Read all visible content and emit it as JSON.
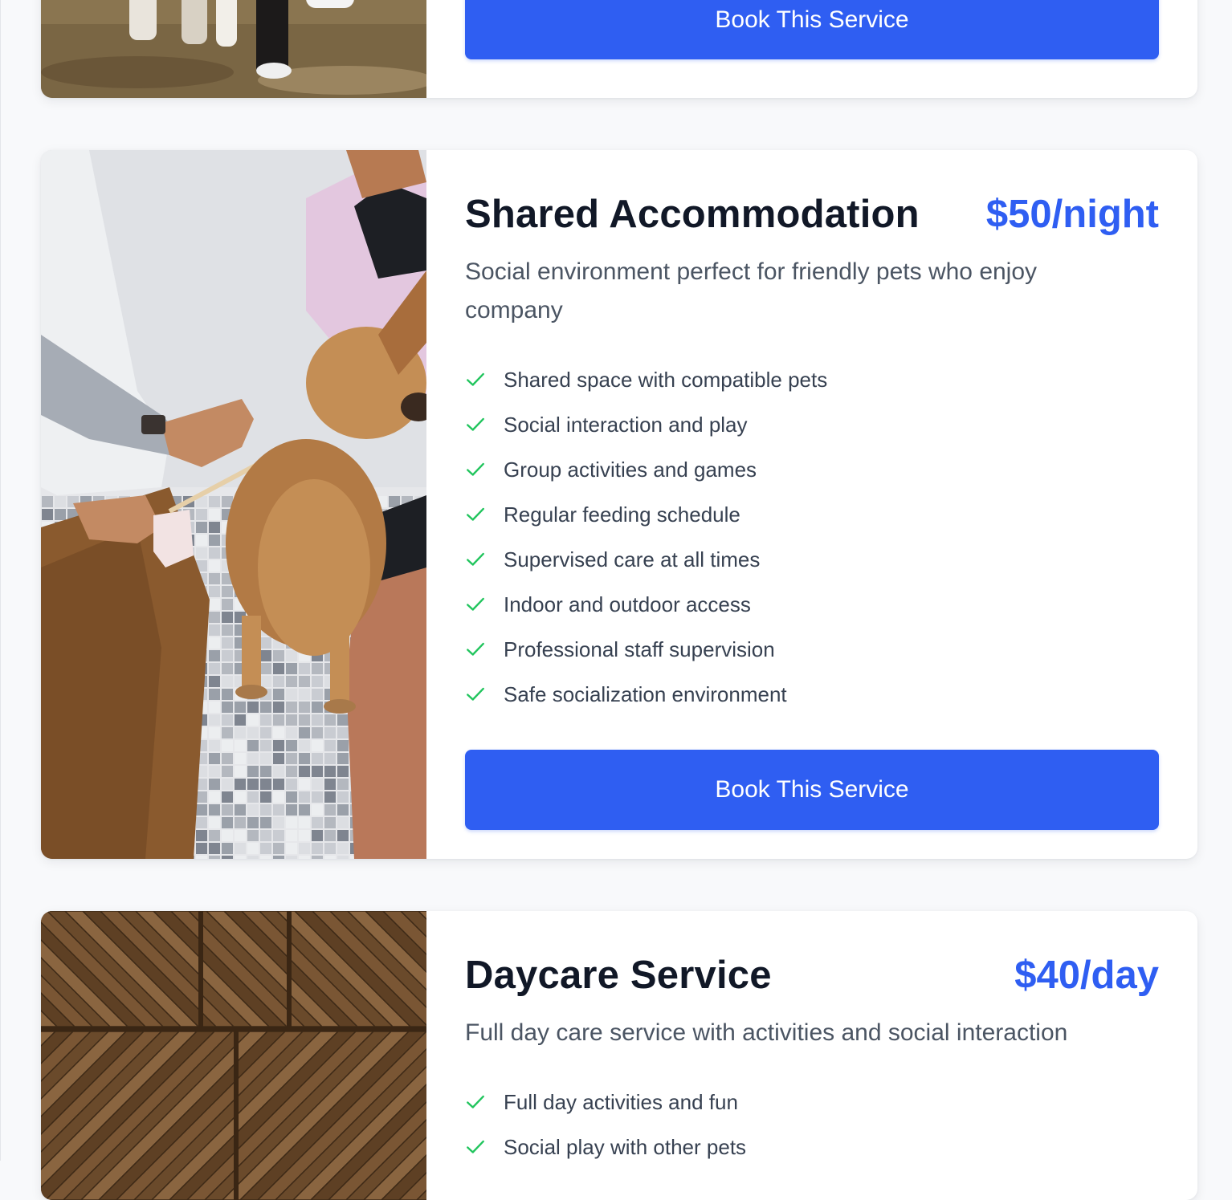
{
  "services": [
    {
      "book_label": "Book This Service"
    },
    {
      "title": "Shared Accommodation",
      "price": "$50/night",
      "description": "Social environment perfect for friendly pets who enjoy company",
      "features": [
        "Shared space with compatible pets",
        "Social interaction and play",
        "Group activities and games",
        "Regular feeding schedule",
        "Supervised care at all times",
        "Indoor and outdoor access",
        "Professional staff supervision",
        "Safe socialization environment"
      ],
      "book_label": "Book This Service"
    },
    {
      "title": "Daycare Service",
      "price": "$40/day",
      "description": "Full day care service with activities and social interaction",
      "features": [
        "Full day activities and fun",
        "Social play with other pets"
      ]
    }
  ],
  "colors": {
    "accent": "#2f5ef2",
    "check": "#22c55e",
    "title": "#111827",
    "body_text": "#4b5563",
    "background": "#f8f9fb"
  },
  "icons": {
    "feature_bullet": "check-icon"
  }
}
